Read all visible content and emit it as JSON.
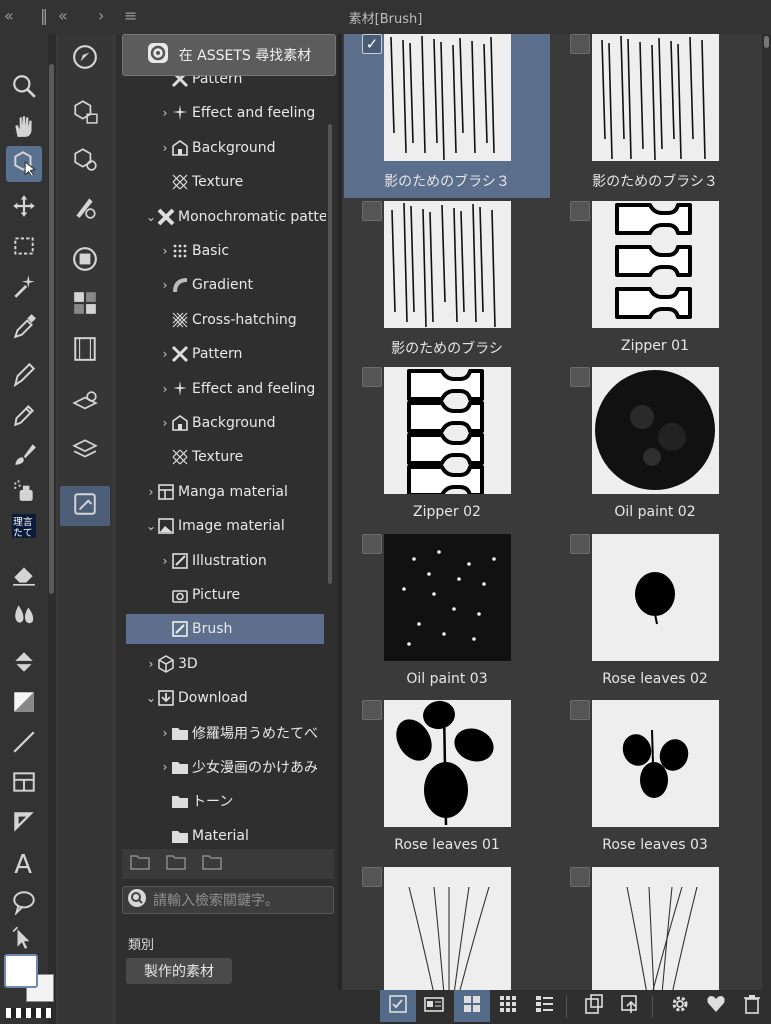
{
  "window": {
    "panel_title": "素材[Brush]",
    "collapse_left_icon": "double-chevron-left-icon",
    "collapse_mid_icon": "double-chevron-left-icon",
    "expand_icon": "chevron-right-icon",
    "menu_icon": "hamburger-icon"
  },
  "tools": [
    {
      "name": "zoom-icon"
    },
    {
      "name": "hand-icon"
    },
    {
      "name": "object-select-icon",
      "active": true
    },
    {
      "name": "move-icon"
    },
    {
      "name": "marquee-select-icon"
    },
    {
      "name": "magic-wand-icon"
    },
    {
      "name": "eyedropper-icon"
    },
    {
      "name": "pen-icon"
    },
    {
      "name": "pencil-icon"
    },
    {
      "name": "brush-icon"
    },
    {
      "name": "airbrush-icon"
    },
    {
      "name": "decoration-icon"
    },
    {
      "name": "eraser-icon"
    },
    {
      "name": "blend-icon"
    },
    {
      "name": "fill-icon"
    },
    {
      "name": "gradient-icon"
    },
    {
      "name": "line-figure-icon"
    },
    {
      "name": "frame-border-icon"
    },
    {
      "name": "ruler-icon"
    },
    {
      "name": "text-icon"
    },
    {
      "name": "balloon-icon"
    },
    {
      "name": "correct-line-icon"
    }
  ],
  "sub_tools": [
    {
      "name": "navigator-icon"
    },
    {
      "name": "3d-layer-settings-icon"
    },
    {
      "name": "3d-object-settings-icon"
    },
    {
      "name": "brush-size-icon"
    },
    {
      "name": "color-circle-icon"
    },
    {
      "name": "color-set-icon"
    },
    {
      "name": "animation-timeline-icon"
    },
    {
      "name": "layer-property-icon"
    },
    {
      "name": "layers-icon"
    },
    {
      "name": "material-panel-icon",
      "active": true
    }
  ],
  "assets_button": {
    "label": "在 ASSETS 尋找素材",
    "icon": "clip-assets-icon"
  },
  "tree": [
    {
      "label": "Pattern",
      "indent": 2,
      "chev": "",
      "icon": "pattern-icon"
    },
    {
      "label": "Effect and feeling",
      "indent": 2,
      "chev": "›",
      "icon": "sparkle-icon"
    },
    {
      "label": "Background",
      "indent": 2,
      "chev": "›",
      "icon": "house-icon"
    },
    {
      "label": "Texture",
      "indent": 2,
      "chev": "",
      "icon": "texture-icon"
    },
    {
      "label": "Monochromatic pattern",
      "indent": 1,
      "chev": "⌄",
      "icon": "mono-pattern-icon"
    },
    {
      "label": "Basic",
      "indent": 2,
      "chev": "›",
      "icon": "dots-icon"
    },
    {
      "label": "Gradient",
      "indent": 2,
      "chev": "›",
      "icon": "gradient-icon"
    },
    {
      "label": "Cross-hatching",
      "indent": 2,
      "chev": "",
      "icon": "crosshatch-icon"
    },
    {
      "label": "Pattern",
      "indent": 2,
      "chev": "›",
      "icon": "pattern-icon"
    },
    {
      "label": "Effect and feeling",
      "indent": 2,
      "chev": "›",
      "icon": "sparkle-icon"
    },
    {
      "label": "Background",
      "indent": 2,
      "chev": "›",
      "icon": "house-icon"
    },
    {
      "label": "Texture",
      "indent": 2,
      "chev": "",
      "icon": "texture-icon"
    },
    {
      "label": "Manga material",
      "indent": 1,
      "chev": "›",
      "icon": "manga-icon"
    },
    {
      "label": "Image material",
      "indent": 1,
      "chev": "⌄",
      "icon": "image-icon"
    },
    {
      "label": "Illustration",
      "indent": 2,
      "chev": "›",
      "icon": "illustration-icon"
    },
    {
      "label": "Picture",
      "indent": 2,
      "chev": "",
      "icon": "camera-icon"
    },
    {
      "label": "Brush",
      "indent": 2,
      "chev": "",
      "icon": "brush-material-icon",
      "selected": true
    },
    {
      "label": "3D",
      "indent": 1,
      "chev": "›",
      "icon": "cube-icon"
    },
    {
      "label": "Download",
      "indent": 1,
      "chev": "⌄",
      "icon": "download-icon"
    },
    {
      "label": "修羅場用うめたてべ",
      "indent": 2,
      "chev": "›",
      "icon": "folder-icon"
    },
    {
      "label": "少女漫画のかけあみ",
      "indent": 2,
      "chev": "›",
      "icon": "folder-icon"
    },
    {
      "label": "トーン",
      "indent": 2,
      "chev": "",
      "icon": "folder-icon"
    },
    {
      "label": "Material",
      "indent": 2,
      "chev": "",
      "icon": "folder-icon"
    }
  ],
  "tree_toolbar": [
    {
      "name": "new-folder-icon"
    },
    {
      "name": "delete-folder-icon"
    },
    {
      "name": "edit-folder-icon"
    }
  ],
  "search": {
    "placeholder": "請輸入檢索關鍵字。",
    "icon": "search-icon"
  },
  "category": {
    "label": "類別",
    "chip": "製作的素材"
  },
  "materials": [
    {
      "caption": "影のためのブラシ３",
      "kind": "hatch",
      "checked": true,
      "selected": true
    },
    {
      "caption": "影のためのブラシ３",
      "kind": "hatch",
      "checked": false
    },
    {
      "caption": "影のためのブラシ",
      "kind": "hatch",
      "checked": false
    },
    {
      "caption": "Zipper 01",
      "kind": "zipper1",
      "checked": false
    },
    {
      "caption": "Zipper 02",
      "kind": "zipper2",
      "checked": false
    },
    {
      "caption": "Oil paint 02",
      "kind": "oil2",
      "checked": false
    },
    {
      "caption": "Oil paint 03",
      "kind": "oil3",
      "checked": false
    },
    {
      "caption": "Rose leaves 02",
      "kind": "leaf1",
      "checked": false
    },
    {
      "caption": "Rose leaves 01",
      "kind": "leaf5",
      "checked": false
    },
    {
      "caption": "Rose leaves 03",
      "kind": "leaf3",
      "checked": false
    },
    {
      "caption": "",
      "kind": "grass1",
      "checked": false
    },
    {
      "caption": "",
      "kind": "grass2",
      "checked": false
    }
  ],
  "bottom_bar": [
    {
      "name": "show-checked-icon",
      "on": true
    },
    {
      "name": "detail-view-icon",
      "on": false
    },
    {
      "name": "large-grid-icon",
      "on": true
    },
    {
      "name": "small-grid-icon",
      "on": false
    },
    {
      "name": "list-view-icon",
      "on": false
    },
    {
      "name": "paste-to-canvas-icon",
      "on": false
    },
    {
      "name": "replace-icon",
      "on": false
    },
    {
      "name": "settings-icon",
      "on": false
    },
    {
      "name": "favorite-icon",
      "on": false
    },
    {
      "name": "trash-icon",
      "on": false
    }
  ],
  "colors": {
    "accent": "#5b6e8b",
    "panel": "#2f2f2f",
    "grid_bg": "#3a3a3a",
    "main_color": "#ffffff",
    "sub_color": "#f3f3f3"
  }
}
